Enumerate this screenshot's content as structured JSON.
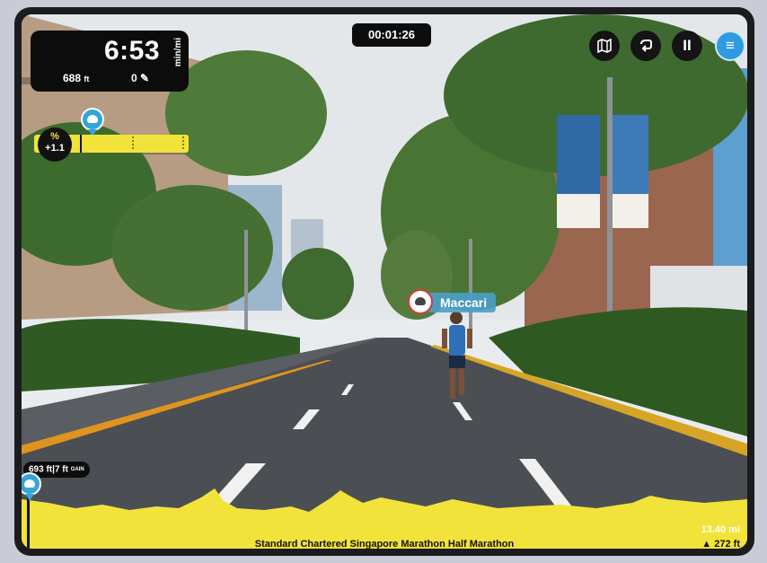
{
  "hud": {
    "pace": "6:53",
    "pace_unit": "min/mi",
    "elevation": "688",
    "elevation_unit": "ft",
    "steps": "0",
    "grade_label": "%",
    "grade_value": "+1.1",
    "timer": "00:01:26"
  },
  "toolbar": {
    "map_icon": "map-icon",
    "loop_icon": "loop-icon",
    "pause_label": "II",
    "menu_label": "≡"
  },
  "runner": {
    "name": "Maccari"
  },
  "elevation_gain": {
    "current": "693 ft",
    "gain": "7 ft",
    "tag": "GAIN"
  },
  "course": {
    "title": "Standard Chartered Singapore Marathon Half Marathon",
    "distance": "13.40 mi",
    "total_elevation": "272 ft"
  },
  "colors": {
    "accent_yellow": "#f2e33a",
    "accent_blue": "#2e9be0"
  }
}
